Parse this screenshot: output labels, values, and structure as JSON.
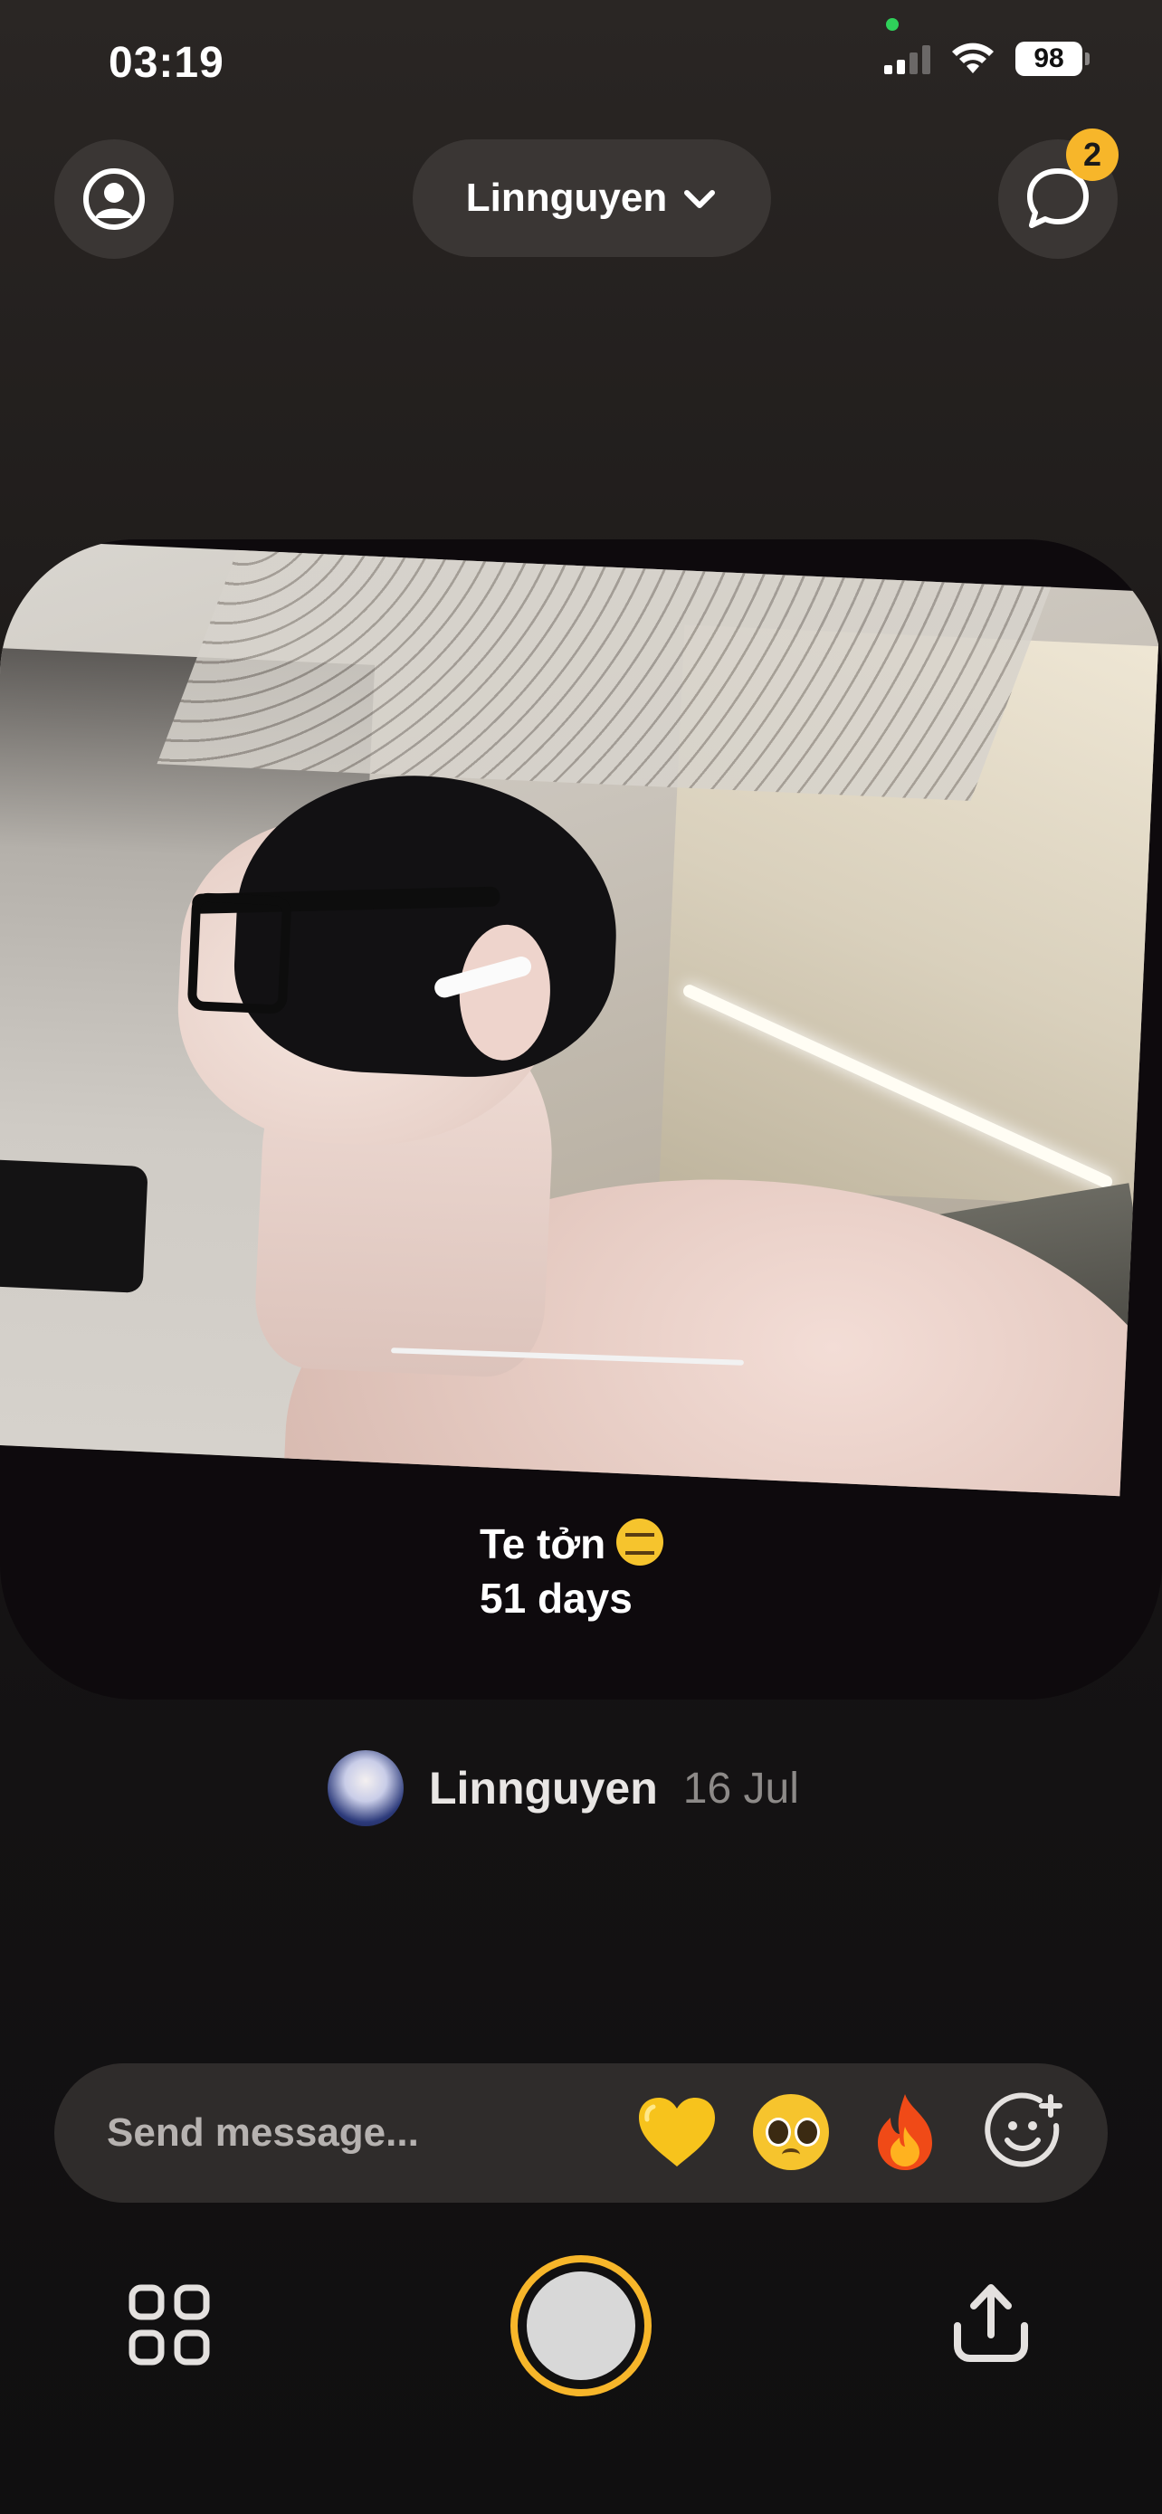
{
  "status_bar": {
    "time": "03:19",
    "battery": "98"
  },
  "header": {
    "profile_icon": "person-circle-icon",
    "friend_selector_label": "Linnguyen",
    "chat_icon": "chat-bubble-icon",
    "chat_badge_count": "2"
  },
  "post": {
    "caption_line1": "Te tởn",
    "caption_emoji": "expressionless-face",
    "caption_line2": "51 days",
    "author_name": "Linnguyen",
    "date": "16 Jul"
  },
  "composer": {
    "placeholder": "Send message...",
    "reactions": [
      "yellow-heart",
      "pleading-face",
      "fire"
    ],
    "add_reaction_icon": "add-emoji-icon"
  },
  "bottom_nav": {
    "grid_icon": "grid-icon",
    "shutter": "shutter-button",
    "share_icon": "share-icon"
  },
  "colors": {
    "accent": "#f7b62a",
    "pill_bg": "#3a3634",
    "bar_bg": "#2f2c2b"
  }
}
